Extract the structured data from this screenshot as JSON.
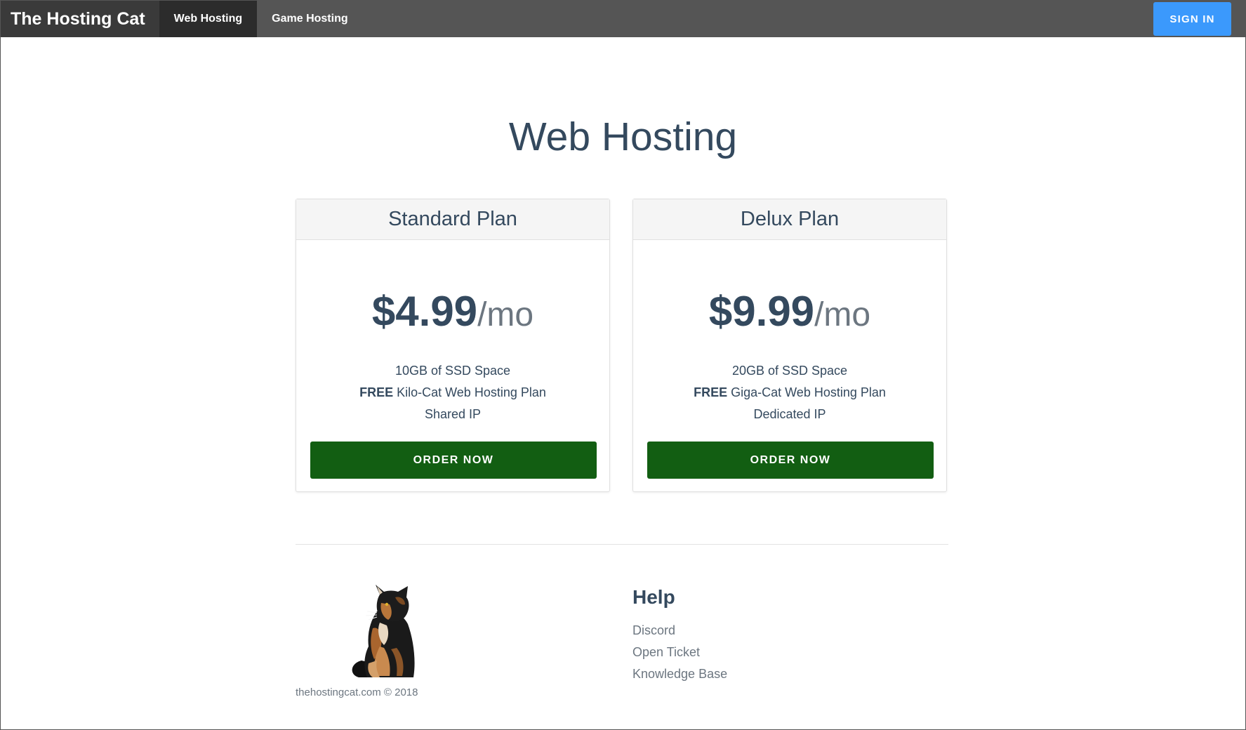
{
  "navbar": {
    "brand": "The Hosting Cat",
    "items": [
      {
        "label": "Web Hosting",
        "active": true
      },
      {
        "label": "Game Hosting",
        "active": false
      }
    ],
    "signin_label": "SIGN IN",
    "colors": {
      "bar": "#555555",
      "active": "#2c2c2c",
      "signin": "#3b99fc"
    }
  },
  "page": {
    "title": "Web Hosting"
  },
  "plans": [
    {
      "name": "Standard Plan",
      "price": "$4.99",
      "unit": "/mo",
      "features": {
        "space": "10GB of SSD Space",
        "free_prefix": "FREE",
        "free_text": " Kilo-Cat Web Hosting Plan",
        "ip": "Shared IP"
      },
      "order_label": "ORDER NOW"
    },
    {
      "name": "Delux Plan",
      "price": "$9.99",
      "unit": "/mo",
      "features": {
        "space": "20GB of SSD Space",
        "free_prefix": "FREE",
        "free_text": " Giga-Cat Web Hosting Plan",
        "ip": "Dedicated IP"
      },
      "order_label": "ORDER NOW"
    }
  ],
  "footer": {
    "logo_icon": "cat-logo-icon",
    "copyright": "thehostingcat.com © 2018",
    "help": {
      "title": "Help",
      "links": [
        "Discord",
        "Open Ticket",
        "Knowledge Base"
      ]
    }
  },
  "colors": {
    "text": "#34495e",
    "muted": "#6c7680",
    "order_button": "#125e12"
  }
}
